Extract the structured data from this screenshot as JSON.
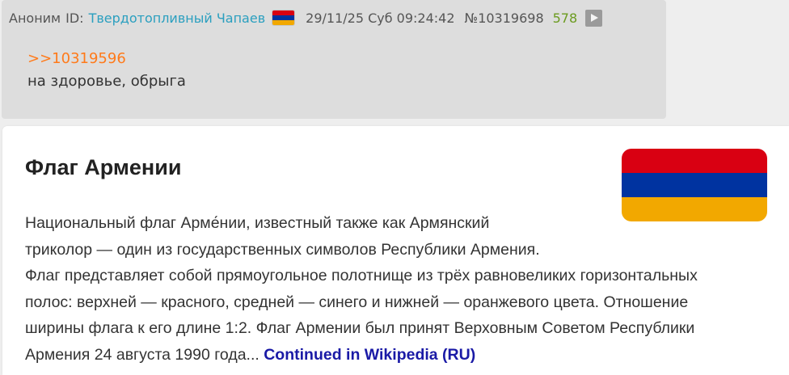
{
  "post": {
    "author": "Аноним",
    "id_label": "ID:",
    "poster_name": "Твердотопливный Чапаев",
    "flag_colors": [
      "#d90012",
      "#0033a0",
      "#f2a800"
    ],
    "date": "29/11/25 Суб 09:24:42",
    "number": "№10319698",
    "reply_count": "578",
    "play_icon": "play-icon",
    "reply_link": ">>10319596",
    "text": "на здоровье, обрыга"
  },
  "wiki_card": {
    "title": "Флаг Армении",
    "flag_colors": [
      "#d90012",
      "#0033a0",
      "#f2a800"
    ],
    "lines": [
      "Национальный флаг Арме́нии, известный также как Армянский",
      "триколор — один из государственных символов Республики Армения.",
      "Флаг представляет собой прямоугольное полотнище из трёх равновеликих горизонтальных",
      "полос: верхней — красного, средней — синего и нижней — оранжевого цвета. Отношение",
      "ширины флага к его длине 1:2. Флаг Армении был принят Верховным Советом Республики"
    ],
    "last_line": "Армения 24 августа 1990 года... ",
    "link_text": "Continued in Wikipedia (RU)"
  }
}
